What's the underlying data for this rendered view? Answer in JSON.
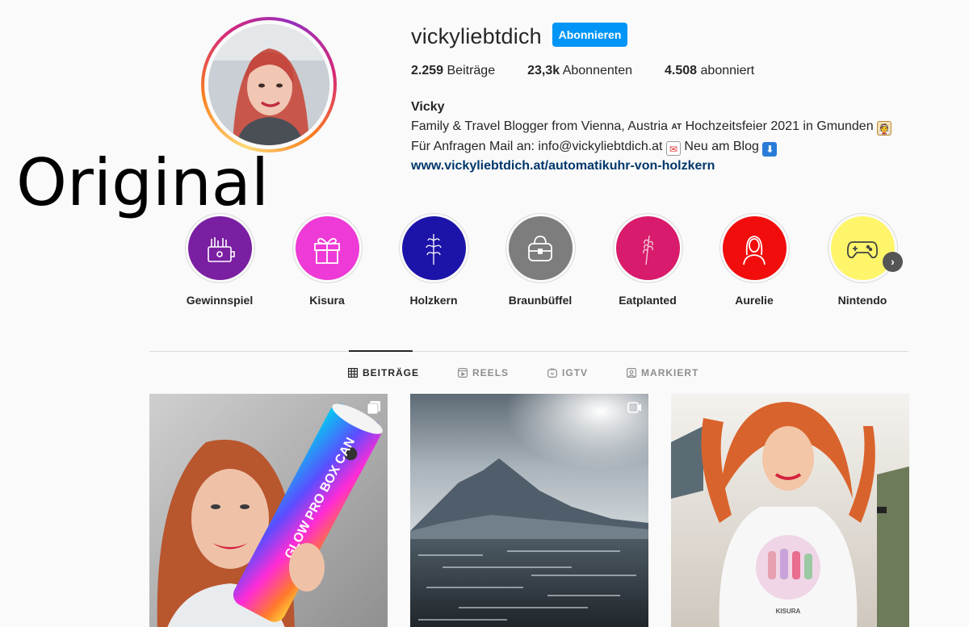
{
  "overlay_label": "Original",
  "profile": {
    "username": "vickyliebtdich",
    "follow_label": "Abonnieren",
    "stats": [
      {
        "value": "2.259",
        "label": "Beiträge"
      },
      {
        "value": "23,3k",
        "label": "Abonnenten"
      },
      {
        "value": "4.508",
        "label": "abonniert"
      }
    ],
    "bio": {
      "name": "Vicky",
      "line1_a": "Family & Travel Blogger from Vienna, Austria",
      "line1_flag": "AT",
      "line1_b": "Hochzeitsfeier 2021 in Gmunden",
      "line2_a": "Für Anfragen Mail an: info@vickyliebtdich.at",
      "line2_b": "Neu am Blog",
      "link": "www.vickyliebtdich.at/automatikuhr-von-holzkern"
    }
  },
  "highlights": [
    {
      "label": "Gewinnspiel",
      "color": "#7a1fa2",
      "icon": "gift-bag-icon"
    },
    {
      "label": "Kisura",
      "color": "#ee3ad6",
      "icon": "gift-icon"
    },
    {
      "label": "Holzkern",
      "color": "#1c14a8",
      "icon": "plant-icon"
    },
    {
      "label": "Braunbüffel",
      "color": "#7d7d7d",
      "icon": "handbag-icon"
    },
    {
      "label": "Eatplanted",
      "color": "#d81b6c",
      "icon": "wheat-icon"
    },
    {
      "label": "Aurelie",
      "color": "#f20d0d",
      "icon": "woman-icon"
    },
    {
      "label": "Nintendo",
      "color": "#fff56a",
      "icon": "gamepad-icon"
    }
  ],
  "tabs": [
    {
      "label": "BEITRÄGE",
      "icon": "grid-icon",
      "active": true
    },
    {
      "label": "REELS",
      "icon": "reels-icon",
      "active": false
    },
    {
      "label": "IGTV",
      "icon": "igtv-icon",
      "active": false
    },
    {
      "label": "MARKIERT",
      "icon": "tagged-icon",
      "active": false
    }
  ],
  "posts": [
    {
      "name": "post-woman-with-glow-box",
      "badge": "carousel-icon",
      "box_text": "GLOW PRO BOX CAN"
    },
    {
      "name": "post-lake-mountain",
      "badge": "video-icon"
    },
    {
      "name": "post-woman-kisura-shirt",
      "badge": "",
      "shirt_text": "KISURA"
    }
  ]
}
